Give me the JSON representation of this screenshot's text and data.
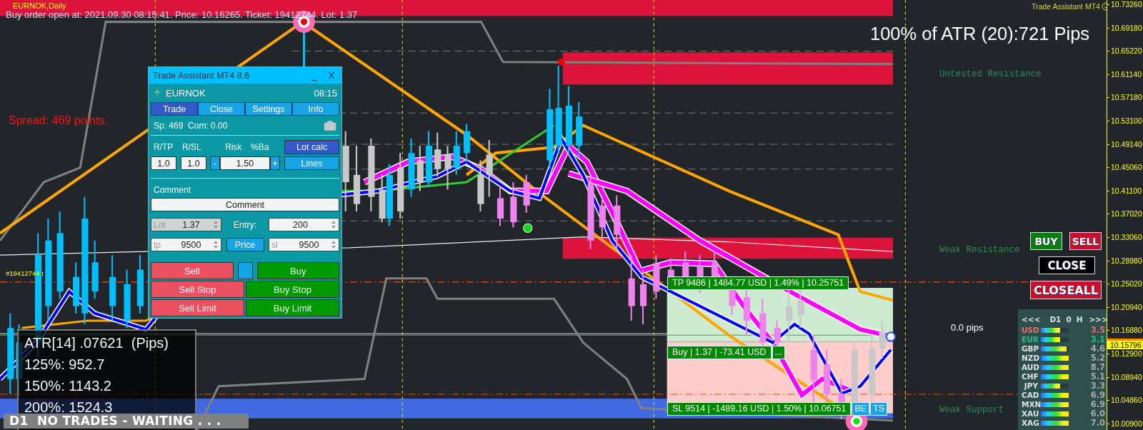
{
  "chart": {
    "symbol": "EURNOK,Daily",
    "order_message": "Buy order open at: 2021.09.30 08:15:41. Price: 10.16265. Ticket: 19412744. Lot: 1.37",
    "spread": "Spread: 469 points.",
    "atr_headline": "100% of ATR (20):721 Pips",
    "brand": "Trade Assistant MT4",
    "order_tag": "#19412744 t",
    "pips_label": "0.0 pips",
    "zone_labels": [
      {
        "text": "Untested Resistance",
        "kind": "top"
      },
      {
        "text": "Weak Resistance",
        "kind": "middle"
      },
      {
        "text": "Weak Support",
        "kind": "bottom"
      }
    ]
  },
  "trade_panel": {
    "title": "Trade Assistant MT4 8.6",
    "minimize": "_",
    "close": "X",
    "symbol": "EURNOK",
    "time": "08:15",
    "tabs": [
      {
        "label": "Trade",
        "selected": true
      },
      {
        "label": "Close",
        "selected": false
      },
      {
        "label": "Settings",
        "selected": false
      },
      {
        "label": "Info",
        "selected": false
      }
    ],
    "stats": "Sp: 469  Com: 0.00",
    "risk_labels": [
      "R/TP",
      "R/SL",
      "Risk",
      "%Ba"
    ],
    "lot_calc": "Lot calc",
    "r_tp": "1.0",
    "r_sl": "1.0",
    "minus": "-",
    "risk": "1.50",
    "plus": "+",
    "lines": "Lines",
    "comment_label": "Comment",
    "comment": "Comment",
    "lot": {
      "label": "Lot",
      "value": "1.37",
      "disabled": true
    },
    "entry_label": "Entry:",
    "entry": "200",
    "tp": {
      "label": "tp",
      "value": "9500"
    },
    "price": "Price",
    "sl": {
      "label": "sl",
      "value": "9500"
    },
    "order_rows": [
      [
        {
          "label": "Sell",
          "kind": "sell"
        },
        {
          "kind": "toggle"
        },
        {
          "label": "Buy",
          "kind": "buy"
        }
      ],
      [
        {
          "label": "Sell Stop",
          "kind": "sell"
        },
        {
          "label": "Buy Stop",
          "kind": "buy"
        }
      ],
      [
        {
          "label": "Sell Limit",
          "kind": "sell"
        },
        {
          "label": "Buy Limit",
          "kind": "buy"
        }
      ]
    ]
  },
  "position": {
    "tp_label": "TP 9486 | 1484.77 USD | 1.49% | 10.25751",
    "entry_label": "Buy | 1.37 | -73.41 USD",
    "more_button": "...",
    "sl_label": "SL 9514 | -1489.16 USD | 1.50% | 10.06751",
    "sl_buttons": [
      "BE",
      "TS"
    ]
  },
  "quick_buttons": [
    {
      "label": "BUY",
      "kind": "buy"
    },
    {
      "label": "SELL",
      "kind": "sell"
    },
    {
      "label": "CLOSE",
      "kind": "close"
    },
    {
      "label": "CLOSEALL",
      "kind": "closeall"
    }
  ],
  "strength": {
    "prev": "<<<",
    "period": "D1",
    "shift": "0",
    "unit": "H",
    "next": ">>>",
    "rows": [
      {
        "code": "USD",
        "level": 0.69,
        "value": "3.5",
        "color": "#e86a6a",
        "highlight": true
      },
      {
        "code": "EUR",
        "level": 0.69,
        "value": "3.1",
        "color": "#22c07a",
        "highlight": true
      },
      {
        "code": "GBP",
        "level": 0.92,
        "value": "4.6",
        "color": "#e0e0e0",
        "highlight": false
      },
      {
        "code": "NZD",
        "level": 1,
        "value": "5.2",
        "color": "#e0e0e0",
        "highlight": false
      },
      {
        "code": "AUD",
        "level": 1,
        "value": "8.7",
        "color": "#e0e0e0",
        "highlight": false
      },
      {
        "code": "CHF",
        "level": 1,
        "value": "5.1",
        "color": "#e0e0e0",
        "highlight": false
      },
      {
        "code": "JPY",
        "level": 0.69,
        "value": "3.3",
        "color": "#e0e0e0",
        "highlight": false
      },
      {
        "code": "CAD",
        "level": 1,
        "value": "6.9",
        "color": "#e0e0e0",
        "highlight": false
      },
      {
        "code": "MXN",
        "level": 1,
        "value": "6.9",
        "color": "#e0e0e0",
        "highlight": false
      },
      {
        "code": "XAU",
        "level": 1,
        "value": "6.0",
        "color": "#e0e0e0",
        "highlight": false
      },
      {
        "code": "XAG",
        "level": 1,
        "value": "7.0",
        "color": "#e0e0e0",
        "highlight": false
      }
    ]
  },
  "atr_box": {
    "lines": [
      "ATR[14] .07621  (Pips)",
      "125%: 952.7",
      "150%: 1143.2",
      "200%: 1524.3"
    ]
  },
  "status_banner": "D1  NO TRADES - WAITING . . .",
  "price_axis": {
    "labels": [
      "10.73260",
      "10.69180",
      "10.65220",
      "10.61140",
      "10.57180",
      "10.53100",
      "10.49140",
      "10.45060",
      "10.41100",
      "10.37020",
      "10.33060",
      "10.28980",
      "10.25020",
      "10.20940",
      "10.16880",
      "10.12900",
      "10.08940",
      "10.04860",
      "10.00900"
    ],
    "current": "10.15796"
  }
}
